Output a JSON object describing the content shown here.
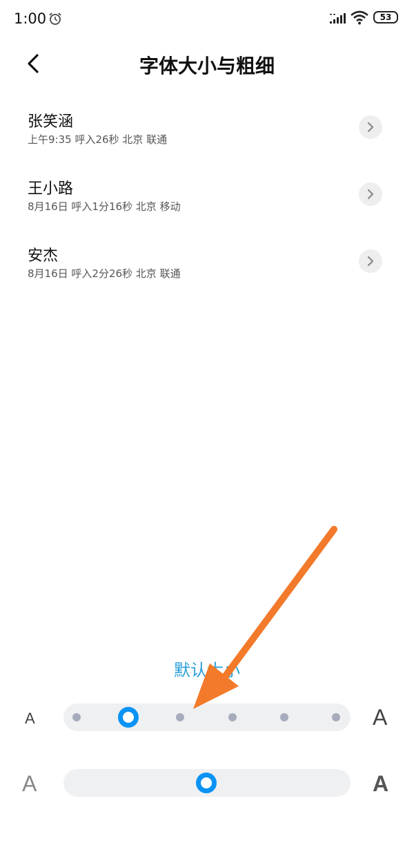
{
  "status_bar": {
    "time": "1:00",
    "battery": "53"
  },
  "header": {
    "title": "字体大小与粗细",
    "icons": [
      "back-arrow-icon"
    ]
  },
  "calls": [
    {
      "name": "张笑涵",
      "detail": "上午9:35 呼入26秒 北京 联通"
    },
    {
      "name": "王小路",
      "detail": "8月16日 呼入1分16秒 北京 移动"
    },
    {
      "name": "安杰",
      "detail": "8月16日 呼入2分26秒 北京 联通"
    }
  ],
  "font_size": {
    "label": "默认大小",
    "small_glyph": "A",
    "large_glyph": "A",
    "steps": 6,
    "selected_step": 2
  },
  "font_weight": {
    "thin_glyph": "A",
    "bold_glyph": "A",
    "level": 0.5
  },
  "colors": {
    "accent": "#0a93f5",
    "label_blue": "#2a9fd8",
    "arrow": "#f27a2a",
    "track": "#eff0f2",
    "dot": "#a7acbd"
  }
}
